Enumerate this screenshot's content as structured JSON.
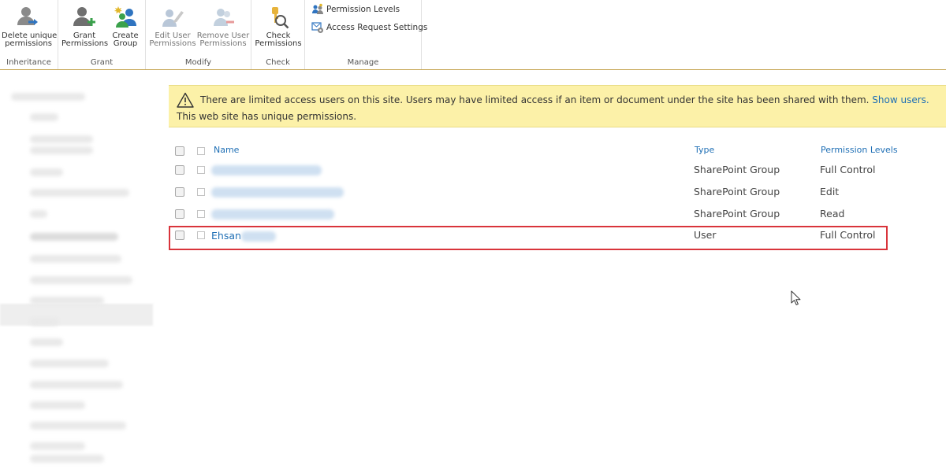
{
  "ribbon": {
    "groups": {
      "inheritance": {
        "label": "Inheritance",
        "delete_unique_line1": "Delete unique",
        "delete_unique_line2": "permissions"
      },
      "grant": {
        "label": "Grant",
        "grant_line1": "Grant",
        "grant_line2": "Permissions",
        "create_line1": "Create",
        "create_line2": "Group"
      },
      "modify": {
        "label": "Modify",
        "edit_line1": "Edit User",
        "edit_line2": "Permissions",
        "remove_line1": "Remove User",
        "remove_line2": "Permissions"
      },
      "check": {
        "label": "Check",
        "check_line1": "Check",
        "check_line2": "Permissions"
      },
      "manage": {
        "label": "Manage",
        "permission_levels": "Permission Levels",
        "access_request_settings": "Access Request Settings"
      }
    }
  },
  "banner": {
    "message": "There are limited access users on this site. Users may have limited access if an item or document under the site has been shared with them.",
    "link": "Show users.",
    "unique_note": "This web site has unique permissions."
  },
  "table": {
    "headers": {
      "name": "Name",
      "type": "Type",
      "permission_levels": "Permission Levels"
    },
    "rows": [
      {
        "name": "",
        "type": "SharePoint Group",
        "level": "Full Control"
      },
      {
        "name": "",
        "type": "SharePoint Group",
        "level": "Edit"
      },
      {
        "name": "",
        "type": "SharePoint Group",
        "level": "Read"
      },
      {
        "name": "Ehsan",
        "type": "User",
        "level": "Full Control"
      }
    ]
  },
  "colors": {
    "link_blue": "#1f6fb5",
    "banner_yellow": "#fcf1a8",
    "highlight_red": "#d9343b"
  }
}
